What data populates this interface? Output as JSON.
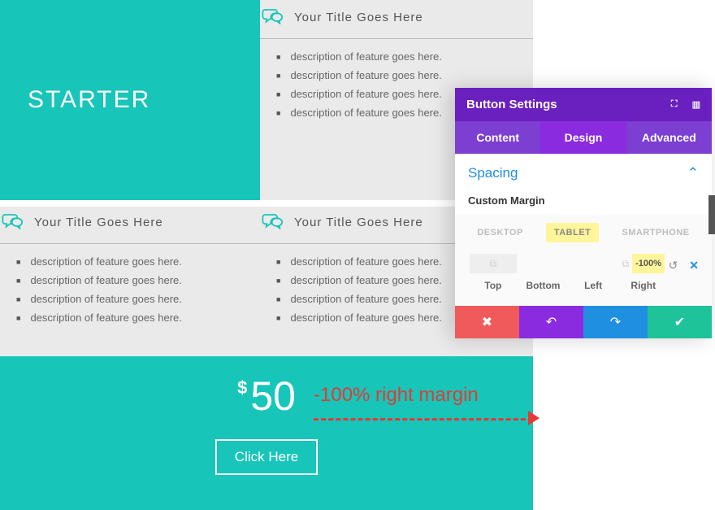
{
  "plan": {
    "name": "STARTER",
    "currency": "$",
    "price": "50",
    "cta": "Click Here"
  },
  "cards": {
    "a": {
      "title": "Your Title Goes Here",
      "items": [
        "description of feature goes here.",
        "description of feature goes here.",
        "description of feature goes here.",
        "description of feature goes here."
      ]
    },
    "b": {
      "title": "Your Title Goes Here",
      "items": [
        "description of feature goes here.",
        "description of feature goes here.",
        "description of feature goes here.",
        "description of feature goes here."
      ]
    },
    "c": {
      "title": "Your Title Goes Here",
      "items": [
        "description of feature goes here.",
        "description of feature goes here.",
        "description of feature goes here.",
        "description of feature goes here."
      ]
    }
  },
  "annotation": "-100% right margin",
  "panel": {
    "title": "Button Settings",
    "tabs": {
      "content": "Content",
      "design": "Design",
      "advanced": "Advanced"
    },
    "section": "Spacing",
    "subhead": "Custom Margin",
    "devices": {
      "desktop": "DESKTOP",
      "tablet": "TABLET",
      "smartphone": "SMARTPHONE"
    },
    "margins": {
      "top": {
        "label": "Top",
        "value": ""
      },
      "bottom": {
        "label": "Bottom",
        "value": ""
      },
      "left": {
        "label": "Left",
        "value": ""
      },
      "right": {
        "label": "Right",
        "value": "-100%"
      }
    }
  }
}
